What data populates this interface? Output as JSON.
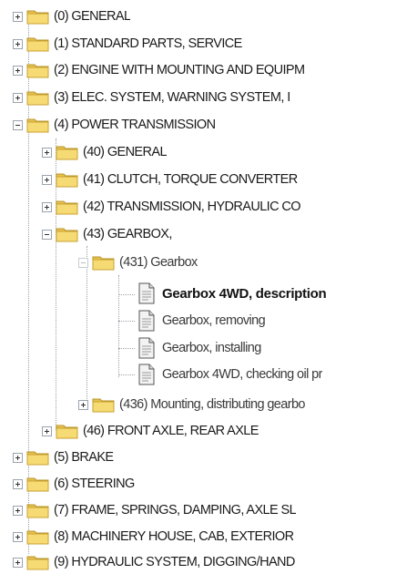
{
  "tree": {
    "top": [
      {
        "label": "(0) GENERAL"
      },
      {
        "label": "(1) STANDARD PARTS, SERVICE"
      },
      {
        "label": "(2) ENGINE WITH MOUNTING AND EQUIPM"
      },
      {
        "label": "(3) ELEC. SYSTEM, WARNING SYSTEM, I"
      },
      {
        "label": "(4) POWER TRANSMISSION"
      }
    ],
    "power_transmission": [
      {
        "label": "(40) GENERAL"
      },
      {
        "label": "(41) CLUTCH, TORQUE CONVERTER"
      },
      {
        "label": "(42) TRANSMISSION, HYDRAULIC CO"
      },
      {
        "label": "(43) GEARBOX,"
      }
    ],
    "gearbox_group": {
      "label": "(431) Gearbox"
    },
    "documents": [
      {
        "label": "Gearbox 4WD, description",
        "selected": true
      },
      {
        "label": "Gearbox, removing"
      },
      {
        "label": "Gearbox, installing"
      },
      {
        "label": "Gearbox 4WD, checking oil pr"
      }
    ],
    "after_docs": [
      {
        "label": "(436) Mounting, distributing gearbo"
      },
      {
        "label": "(46) FRONT AXLE, REAR AXLE"
      }
    ],
    "bottom": [
      {
        "label": "(5) BRAKE"
      },
      {
        "label": "(6) STEERING"
      },
      {
        "label": "(7) FRAME, SPRINGS, DAMPING, AXLE SL"
      },
      {
        "label": "(8) MACHINERY HOUSE, CAB, EXTERIOR"
      },
      {
        "label": "(9) HYDRAULIC SYSTEM, DIGGING/HAND"
      }
    ]
  },
  "colors": {
    "folder": "#f4d468",
    "folder_dark": "#d9b23c",
    "line": "#9aa0a6"
  }
}
